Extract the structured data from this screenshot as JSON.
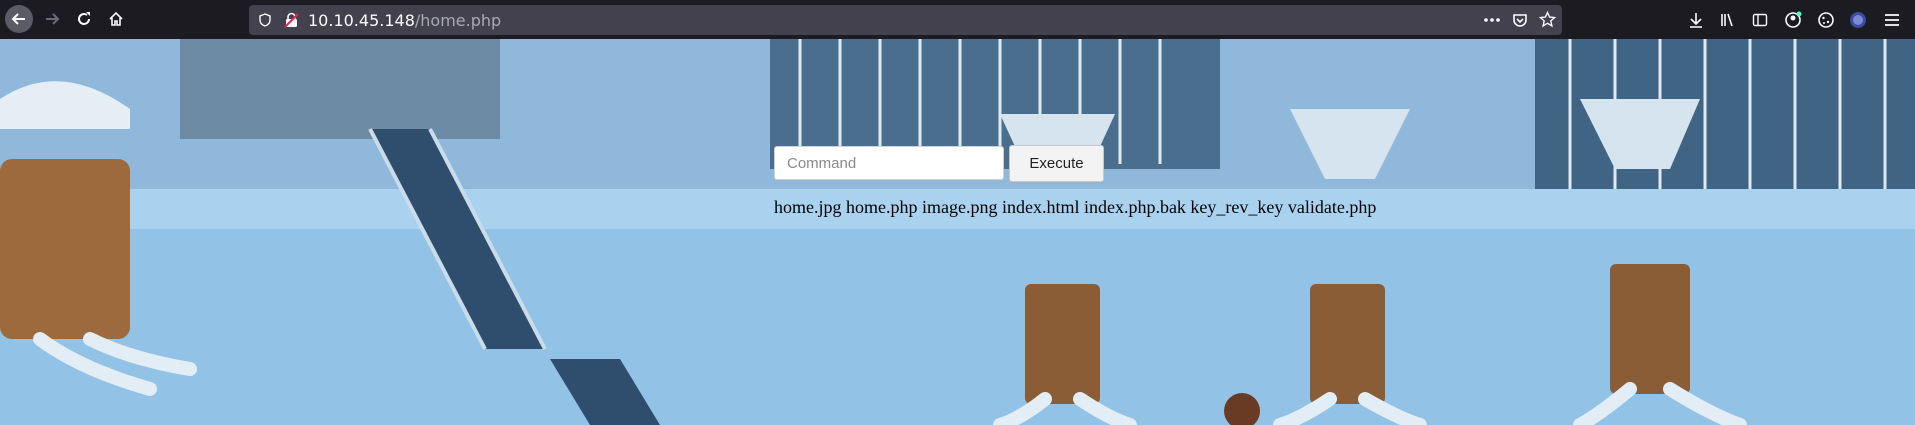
{
  "browser": {
    "url_host": "10.10.45.148",
    "url_path": "/home.php",
    "icons": [
      "back-icon",
      "forward-icon",
      "reload-icon",
      "home-icon",
      "shield-icon",
      "insecure-lock-icon",
      "more-icon",
      "pocket-icon",
      "bookmark-star-icon",
      "download-icon",
      "library-icon",
      "sidebar-icon",
      "account-icon",
      "extension-cookie-icon",
      "profile-icon",
      "menu-icon"
    ]
  },
  "page": {
    "command_placeholder": "Command",
    "execute_label": "Execute",
    "output": "home.jpg home.php image.png index.html index.php.bak key_rev_key validate.php"
  }
}
